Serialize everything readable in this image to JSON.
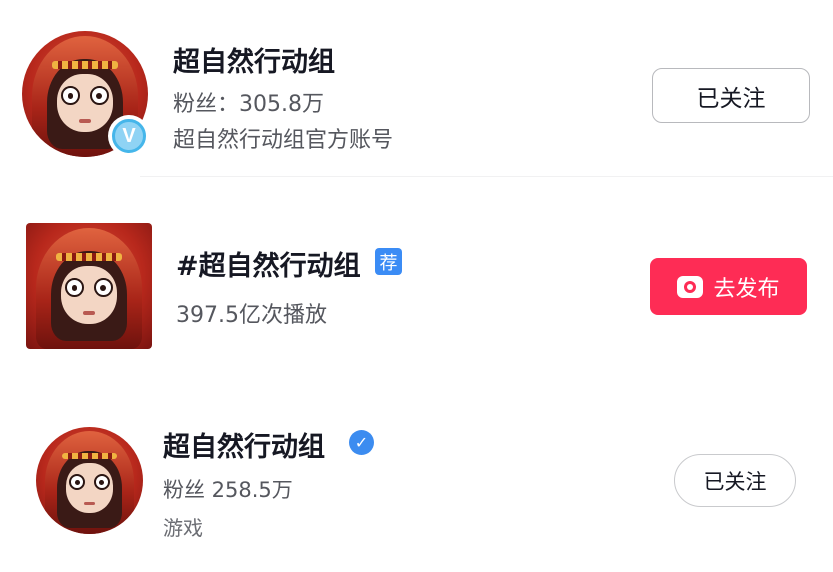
{
  "account_card": {
    "name": "超自然行动组",
    "fans": "粉丝：305.8万",
    "description": "超自然行动组官方账号",
    "badge_letter": "V",
    "follow_label": "已关注"
  },
  "topic_card": {
    "title": "#超自然行动组",
    "recommend_badge": "荐",
    "plays": "397.5亿次播放",
    "publish_label": "去发布"
  },
  "user_card": {
    "name": "超自然行动组",
    "verified_mark": "✓",
    "fans": "粉丝 258.5万",
    "category": "游戏",
    "follow_label": "已关注"
  },
  "colors": {
    "accent": "#fe2c55",
    "verified_blue": "#3c8cf0",
    "recommend_blue": "#3b8cf5",
    "v_badge": "#45b6ea"
  },
  "icons": {
    "avatar": "hooded-character-avatar",
    "verified": "check-circle-icon",
    "camera": "camera-icon"
  }
}
